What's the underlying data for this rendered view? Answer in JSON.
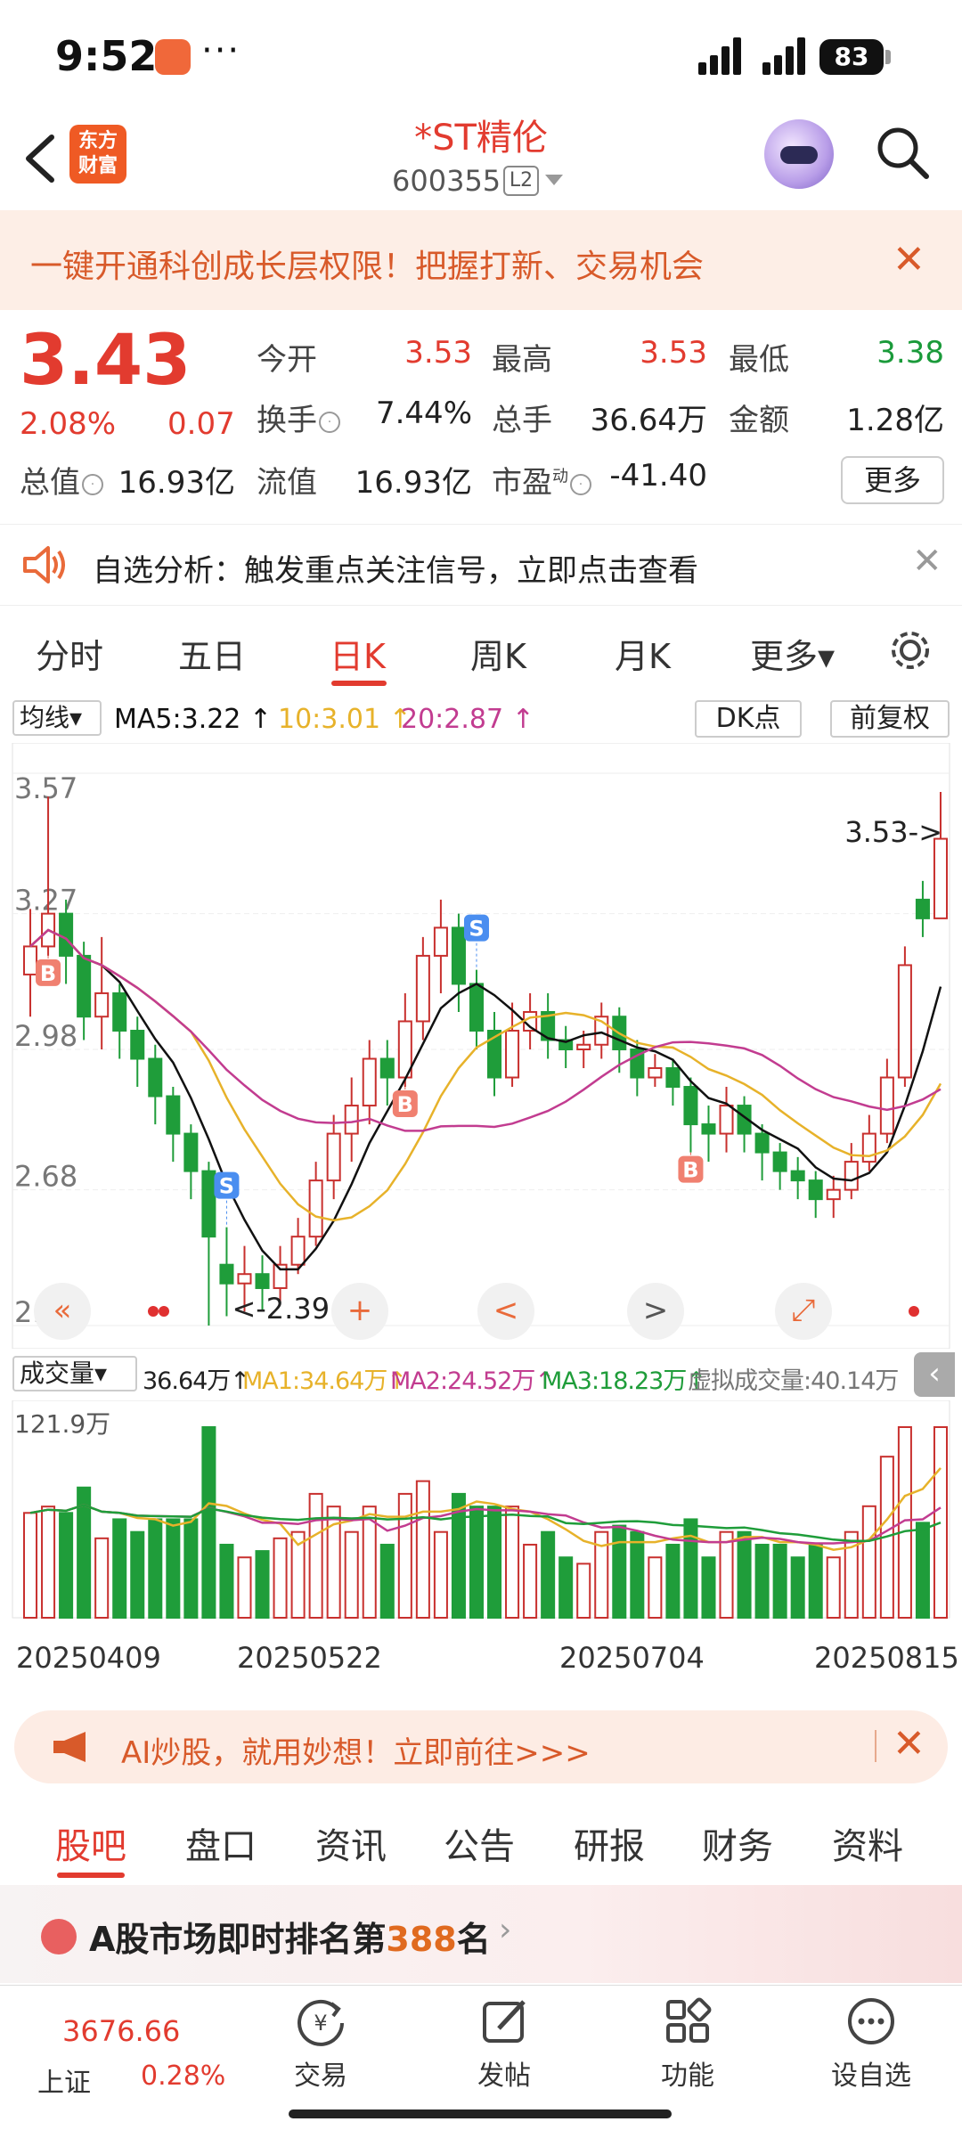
{
  "status_bar": {
    "time": "9:52",
    "more": "···",
    "battery": "83"
  },
  "header": {
    "back_icon": "back-arrow-icon",
    "logo_line1": "东方",
    "logo_line2": "财富",
    "stock_name": "*ST精伦",
    "stock_code": "600355",
    "level_badge": "L2",
    "search_icon": "search-icon"
  },
  "banner": {
    "text": "一键开通科创成长层权限！把握打新、交易机会",
    "close": "✕"
  },
  "quote": {
    "price": "3.43",
    "change_pct": "2.08%",
    "change_amt": "0.07",
    "open_label": "今开",
    "open": "3.53",
    "high_label": "最高",
    "high": "3.53",
    "low_label": "最低",
    "low": "3.38",
    "turnover_label": "换手",
    "turnover": "7.44%",
    "volume_label": "总手",
    "volume": "36.64万",
    "amount_label": "金额",
    "amount": "1.28亿",
    "mcap_label": "总值",
    "mcap": "16.93亿",
    "float_label": "流值",
    "float": "16.93亿",
    "pe_label": "市盈",
    "pe_sup": "动",
    "pe": "-41.40",
    "more": "更多"
  },
  "notice": {
    "text": "自选分析：触发重点关注信号，立即点击查看",
    "close": "✕"
  },
  "period_tabs": [
    "分时",
    "五日",
    "日K",
    "周K",
    "月K",
    "更多▾"
  ],
  "period_active": "日K",
  "indicators": {
    "selector": "均线▾",
    "ma5": "MA5:3.22 ↑",
    "ma10": "10:3.01 ↑",
    "ma20": "20:2.87 ↑",
    "dk": "DK点",
    "adjust": "前复权"
  },
  "colors": {
    "up": "#c8302e",
    "down": "#1f9d3a",
    "ma5": "#111111",
    "ma10": "#e7b22a",
    "ma20": "#c23c90"
  },
  "chart_data": {
    "type": "candlestick",
    "y_ticks": [
      "3.57",
      "3.27",
      "2.98",
      "2.68",
      "2.39"
    ],
    "ylim": [
      2.39,
      3.57
    ],
    "max_label": "3.53->",
    "min_label": "<-2.39",
    "signals": [
      "B",
      "S",
      "B",
      "S",
      "B"
    ],
    "candles": [
      [
        3.14,
        3.2,
        3.05,
        3.28
      ],
      [
        3.2,
        3.27,
        3.18,
        3.52
      ],
      [
        3.27,
        3.18,
        3.12,
        3.3
      ],
      [
        3.18,
        3.05,
        3.0,
        3.21
      ],
      [
        3.05,
        3.1,
        2.98,
        3.22
      ],
      [
        3.1,
        3.02,
        2.96,
        3.12
      ],
      [
        3.02,
        2.96,
        2.9,
        3.05
      ],
      [
        2.96,
        2.88,
        2.82,
        2.99
      ],
      [
        2.88,
        2.8,
        2.74,
        2.9
      ],
      [
        2.8,
        2.72,
        2.66,
        2.82
      ],
      [
        2.72,
        2.58,
        2.39,
        2.74
      ],
      [
        2.52,
        2.48,
        2.41,
        2.6
      ],
      [
        2.48,
        2.5,
        2.42,
        2.56
      ],
      [
        2.5,
        2.47,
        2.42,
        2.54
      ],
      [
        2.47,
        2.52,
        2.44,
        2.56
      ],
      [
        2.52,
        2.58,
        2.5,
        2.62
      ],
      [
        2.58,
        2.7,
        2.56,
        2.74
      ],
      [
        2.7,
        2.8,
        2.66,
        2.84
      ],
      [
        2.8,
        2.86,
        2.74,
        2.92
      ],
      [
        2.86,
        2.96,
        2.82,
        3.0
      ],
      [
        2.96,
        2.92,
        2.86,
        3.0
      ],
      [
        2.92,
        3.04,
        2.9,
        3.1
      ],
      [
        3.04,
        3.18,
        3.0,
        3.22
      ],
      [
        3.18,
        3.24,
        3.1,
        3.3
      ],
      [
        3.24,
        3.12,
        3.06,
        3.27
      ],
      [
        3.12,
        3.02,
        2.98,
        3.15
      ],
      [
        3.02,
        2.92,
        2.88,
        3.06
      ],
      [
        2.92,
        3.02,
        2.9,
        3.08
      ],
      [
        3.02,
        3.06,
        2.98,
        3.1
      ],
      [
        3.06,
        3.0,
        2.96,
        3.1
      ],
      [
        3.0,
        2.98,
        2.94,
        3.03
      ],
      [
        2.98,
        2.99,
        2.94,
        3.02
      ],
      [
        2.99,
        3.05,
        2.96,
        3.08
      ],
      [
        3.05,
        2.98,
        2.93,
        3.07
      ],
      [
        2.98,
        2.92,
        2.88,
        3.0
      ],
      [
        2.92,
        2.94,
        2.9,
        2.97
      ],
      [
        2.94,
        2.9,
        2.86,
        2.96
      ],
      [
        2.9,
        2.82,
        2.76,
        2.92
      ],
      [
        2.82,
        2.8,
        2.74,
        2.86
      ],
      [
        2.8,
        2.86,
        2.76,
        2.9
      ],
      [
        2.86,
        2.8,
        2.76,
        2.88
      ],
      [
        2.8,
        2.76,
        2.7,
        2.82
      ],
      [
        2.76,
        2.72,
        2.68,
        2.78
      ],
      [
        2.72,
        2.7,
        2.66,
        2.75
      ],
      [
        2.7,
        2.66,
        2.62,
        2.72
      ],
      [
        2.66,
        2.68,
        2.62,
        2.71
      ],
      [
        2.68,
        2.74,
        2.66,
        2.78
      ],
      [
        2.74,
        2.8,
        2.72,
        2.84
      ],
      [
        2.8,
        2.92,
        2.78,
        2.96
      ],
      [
        2.92,
        3.16,
        2.9,
        3.2
      ],
      [
        3.3,
        3.26,
        3.22,
        3.34
      ],
      [
        3.26,
        3.43,
        3.38,
        3.53
      ]
    ]
  },
  "controls": [
    "«",
    "+",
    "<",
    ">",
    "⤢"
  ],
  "volume": {
    "selector": "成交量▾",
    "vol": "36.64万↑",
    "ma1": "MA1:34.64万↑",
    "ma2": "MA2:24.52万↑",
    "ma3": "MA3:18.23万↑",
    "virtual": "虚拟成交量:40.14万",
    "max_label": "121.9万"
  },
  "dates": [
    "20250409",
    "20250522",
    "20250704",
    "20250815"
  ],
  "ai_banner": {
    "text": "AI炒股，就用妙想！立即前往>>>",
    "close": "✕"
  },
  "content_tabs": [
    "股吧",
    "盘口",
    "资讯",
    "公告",
    "研报",
    "财务",
    "资料"
  ],
  "content_active": "股吧",
  "rank": {
    "prefix": "A股市场即时排名第",
    "number": "388",
    "suffix": "名",
    "chevron": "›"
  },
  "bottom": {
    "index_value": "3676.66",
    "index_name": "上证",
    "index_change": "0.28%",
    "nav": [
      {
        "label": "交易",
        "icon": "yuan-trade-icon"
      },
      {
        "label": "发帖",
        "icon": "edit-post-icon"
      },
      {
        "label": "功能",
        "icon": "grid-icon"
      },
      {
        "label": "设自选",
        "icon": "more-dots-icon"
      }
    ]
  }
}
